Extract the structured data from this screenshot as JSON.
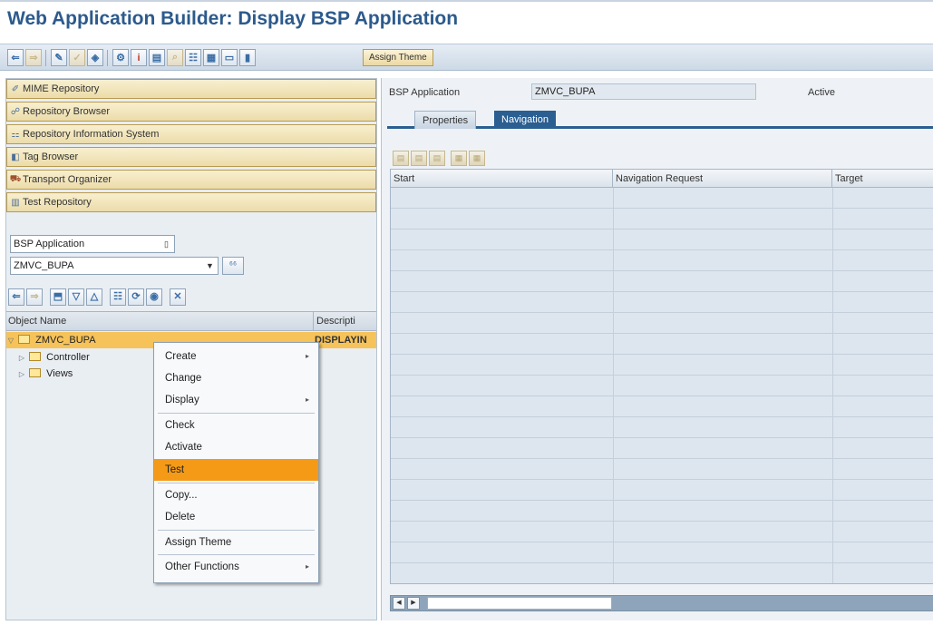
{
  "window": {
    "title": "Web Application Builder: Display BSP Application"
  },
  "toolbar": {
    "assign_theme": "Assign Theme",
    "buttons": [
      "back-arrow",
      "forward-arrow",
      "edit",
      "check",
      "activate",
      "test",
      "display",
      "where-used",
      "info",
      "hierarchy",
      "grid",
      "frame",
      "screen"
    ]
  },
  "nav": {
    "items": [
      {
        "label": "MIME Repository",
        "icon": "mime-icon"
      },
      {
        "label": "Repository Browser",
        "icon": "tree-icon"
      },
      {
        "label": "Repository Information System",
        "icon": "info-system-icon"
      },
      {
        "label": "Tag Browser",
        "icon": "tag-icon"
      },
      {
        "label": "Transport Organizer",
        "icon": "truck-icon"
      },
      {
        "label": "Test Repository",
        "icon": "test-icon"
      }
    ]
  },
  "browser": {
    "object_type": "BSP Application",
    "object_name": "ZMVC_BUPA",
    "glasses_label": "⁶⁶"
  },
  "tree": {
    "col_object": "Object Name",
    "col_desc": "Descripti",
    "root": {
      "label": "ZMVC_BUPA",
      "desc": "DISPLAYIN"
    },
    "children": [
      {
        "label": "Controller"
      },
      {
        "label": "Views"
      }
    ]
  },
  "context_menu": {
    "items": [
      {
        "label": "Create",
        "submenu": true
      },
      {
        "label": "Change",
        "submenu": false
      },
      {
        "label": "Display",
        "submenu": true
      },
      {
        "label": "Check",
        "submenu": false
      },
      {
        "label": "Activate",
        "submenu": false
      },
      {
        "label": "Test",
        "submenu": false,
        "highlighted": true
      },
      {
        "label": "Copy...",
        "submenu": false
      },
      {
        "label": "Delete",
        "submenu": false
      },
      {
        "label": "Assign Theme",
        "submenu": false
      },
      {
        "label": "Other Functions",
        "submenu": true
      }
    ]
  },
  "detail": {
    "app_label": "BSP Application",
    "app_value": "ZMVC_BUPA",
    "status": "Active",
    "tabs": [
      {
        "label": "Properties"
      },
      {
        "label": "Navigation",
        "active": true
      }
    ],
    "grid_columns": [
      "Start",
      "Navigation Request",
      "Target"
    ]
  },
  "colors": {
    "title": "#2c5a8c",
    "menu_highlight": "#f59a16",
    "tree_selection": "#f6c35a",
    "tab_active": "#2b5e91"
  }
}
